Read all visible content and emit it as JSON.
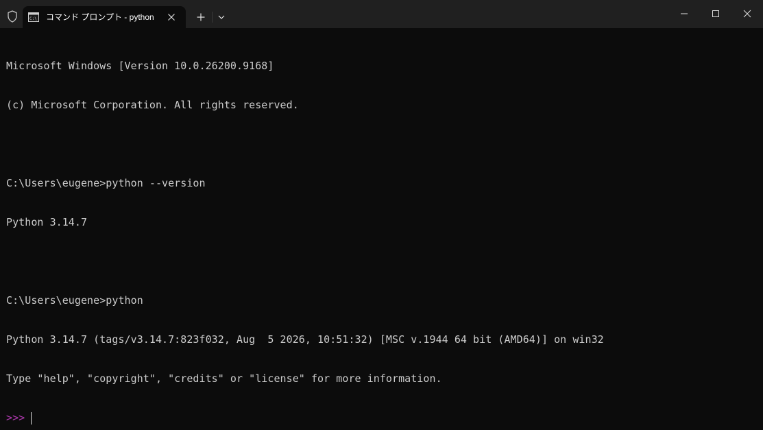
{
  "titlebar": {
    "tab_title": "コマンド プロンプト - python"
  },
  "icons": {
    "shield": "shield-icon",
    "cmd": "cmd-icon",
    "close_tab": "close-icon",
    "new_tab": "plus-icon",
    "dropdown": "chevron-down-icon",
    "minimize": "minimize-icon",
    "maximize": "maximize-icon",
    "close_window": "close-icon"
  },
  "colors": {
    "background": "#0c0c0c",
    "titlebar": "#202020",
    "text": "#cccccc",
    "prompt": "#b33ab3"
  },
  "terminal": {
    "lines": [
      "Microsoft Windows [Version 10.0.26200.9168]",
      "(c) Microsoft Corporation. All rights reserved.",
      "",
      "C:\\Users\\eugene>python --version",
      "Python 3.14.7",
      "",
      "C:\\Users\\eugene>python",
      "Python 3.14.7 (tags/v3.14.7:823f032, Aug  5 2026, 10:51:32) [MSC v.1944 64 bit (AMD64)] on win32",
      "Type \"help\", \"copyright\", \"credits\" or \"license\" for more information."
    ],
    "python_prompt": ">>>"
  }
}
